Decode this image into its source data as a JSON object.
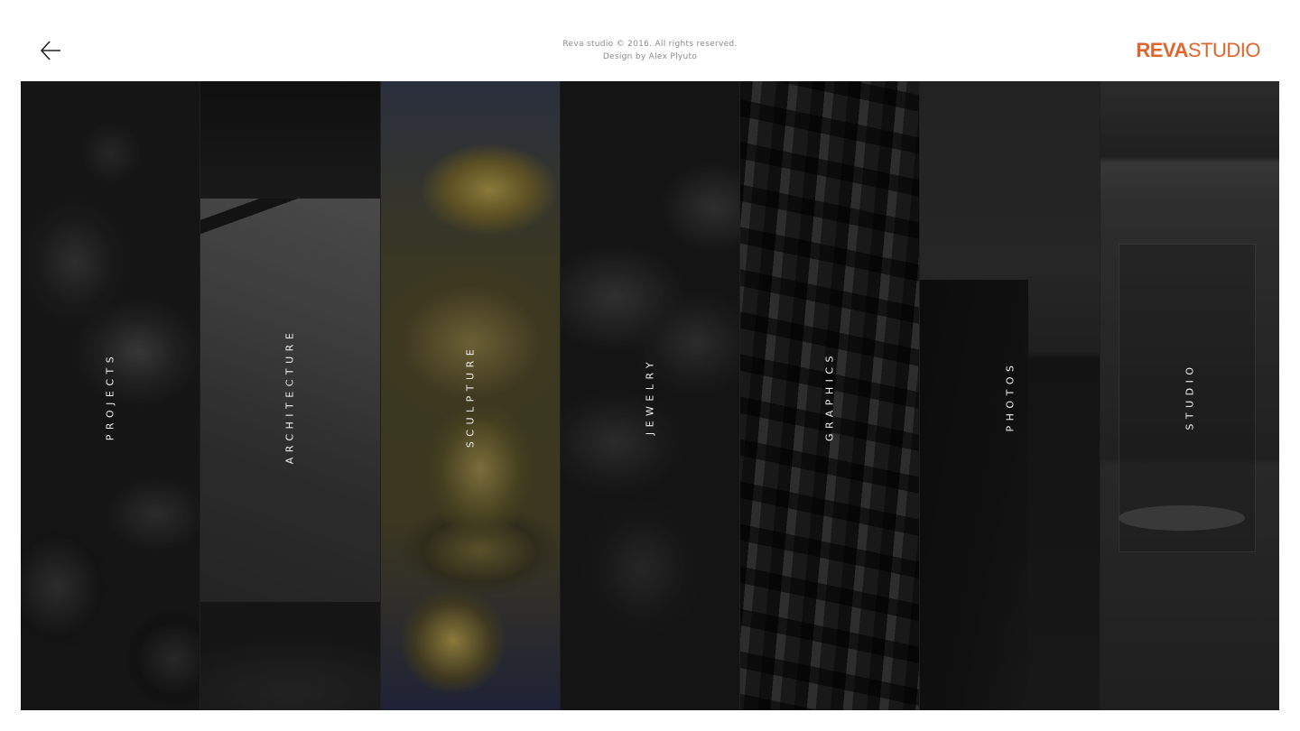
{
  "header": {
    "copyright_line1": "Reva studio © 2016. All rights reserved.",
    "copyright_line2": "Design by Alex Plyuto",
    "logo": {
      "part1": "REVA",
      "part2": "STUDIO",
      "color": "#e0642c"
    },
    "back_icon": "arrow-left-icon"
  },
  "gallery": {
    "panels": [
      {
        "label": "PROJECTS",
        "active": false
      },
      {
        "label": "ARCHITECTURE",
        "active": false
      },
      {
        "label": "SCULPTURE",
        "active": true
      },
      {
        "label": "JEWELRY",
        "active": false
      },
      {
        "label": "GRAPHICS",
        "active": false
      },
      {
        "label": "PHOTOS",
        "active": false
      },
      {
        "label": "STUDIO",
        "active": false
      }
    ]
  }
}
